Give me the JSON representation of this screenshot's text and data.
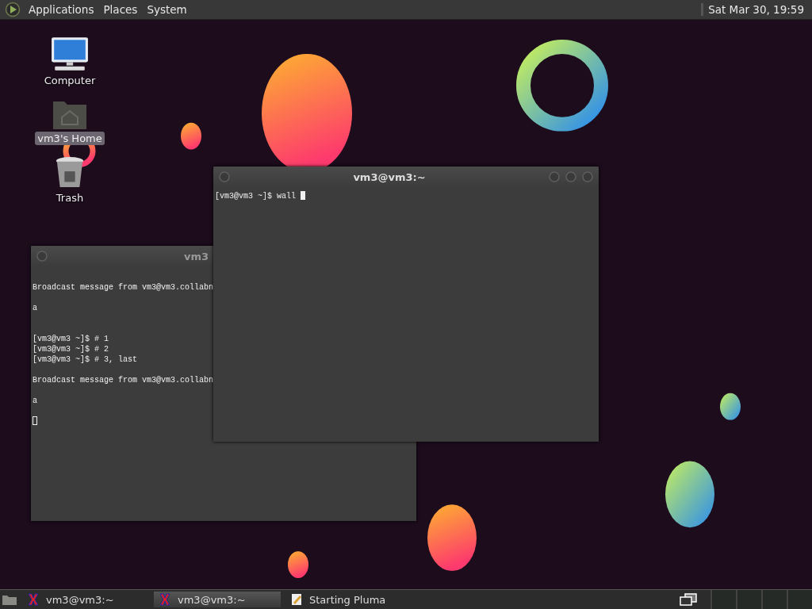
{
  "top_panel": {
    "menus": [
      {
        "label": "Applications"
      },
      {
        "label": "Places"
      },
      {
        "label": "System"
      }
    ],
    "clock": "Sat Mar 30, 19:59"
  },
  "desktop_icons": [
    {
      "kind": "computer",
      "label": "Computer",
      "selected": false
    },
    {
      "kind": "home",
      "label": "vm3's Home",
      "selected": true
    },
    {
      "kind": "trash",
      "label": "Trash",
      "selected": false
    }
  ],
  "windows": [
    {
      "title": "vm3",
      "focused": false,
      "output": "Broadcast message from vm3@vm3.collabn\n\na\n\n\n[vm3@vm3 ~]$ # 1\n[vm3@vm3 ~]$ # 2\n[vm3@vm3 ~]$ # 3, last\n\nBroadcast message from vm3@vm3.collabn\n\na\n\n"
    },
    {
      "title": "vm3@vm3:~",
      "focused": true,
      "output": "[vm3@vm3 ~]$ wall "
    }
  ],
  "taskbar": {
    "items": [
      {
        "kind": "terminal",
        "label": "vm3@vm3:~",
        "selected": false
      },
      {
        "kind": "terminal",
        "label": "vm3@vm3:~",
        "selected": true
      },
      {
        "kind": "editor",
        "label": "Starting Pluma",
        "selected": false
      }
    ]
  }
}
